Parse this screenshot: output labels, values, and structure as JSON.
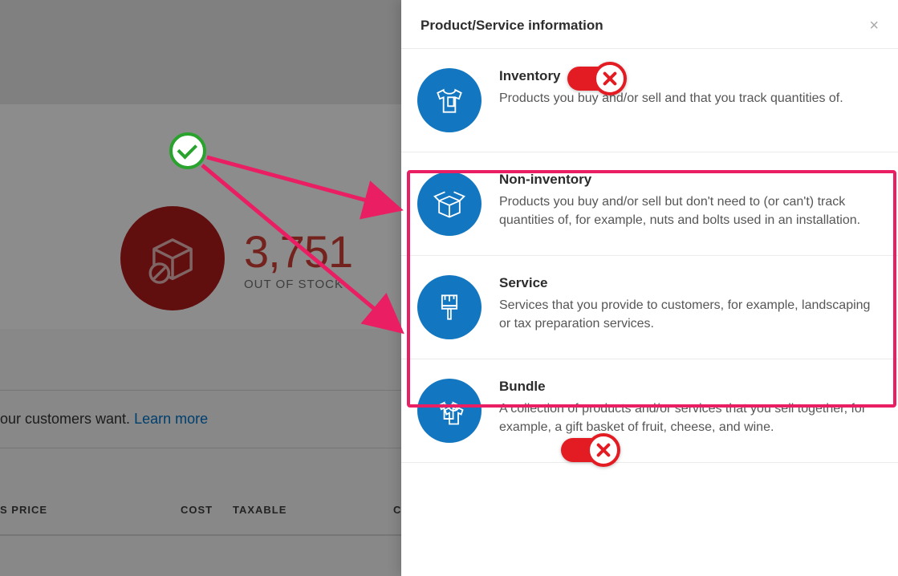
{
  "background": {
    "out_of_stock_value": "3,751",
    "out_of_stock_label": "OUT OF STOCK",
    "learn_prefix": "our customers want. ",
    "learn_link": "Learn more",
    "table_headers": {
      "price": "S PRICE",
      "cost": "COST",
      "taxable": "TAXABLE",
      "c": "C"
    }
  },
  "panel": {
    "title": "Product/Service information",
    "options": [
      {
        "key": "inventory",
        "name": "Inventory",
        "desc": "Products you buy and/or sell and that you track quantities of."
      },
      {
        "key": "non-inventory",
        "name": "Non-inventory",
        "desc": "Products you buy and/or sell but don't need to (or can't) track quantities of, for example, nuts and bolts used in an installation."
      },
      {
        "key": "service",
        "name": "Service",
        "desc": "Services that you provide to customers, for example, landscaping or tax preparation services."
      },
      {
        "key": "bundle",
        "name": "Bundle",
        "desc": "A collection of products and/or services that you sell together, for example, a gift basket of fruit, cheese, and wine."
      }
    ]
  },
  "annotation": {
    "ok_marker": "check",
    "x_marker": "cross"
  }
}
